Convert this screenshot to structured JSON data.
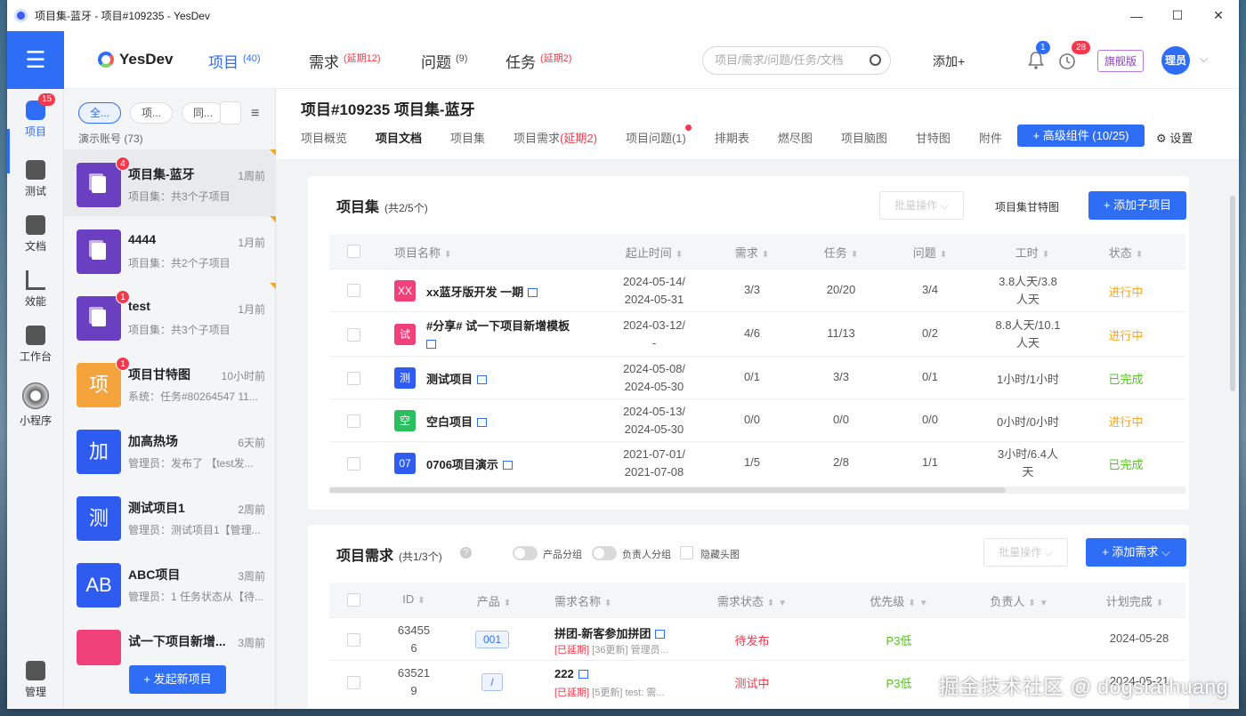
{
  "window": {
    "title": "项目集-蓝牙 - 项目#109235 - YesDev",
    "controls": [
      "—",
      "☐",
      "✕"
    ]
  },
  "rail": {
    "items": [
      {
        "label": "项目",
        "badge": "15",
        "icon": "project-icon"
      },
      {
        "label": "测试",
        "icon": "test-icon"
      },
      {
        "label": "文档",
        "icon": "doc-icon"
      },
      {
        "label": "效能",
        "icon": "chart-icon"
      },
      {
        "label": "工作台",
        "icon": "workbench-icon"
      },
      {
        "label": "小程序",
        "icon": "miniapp-icon"
      },
      {
        "label": "管理",
        "icon": "admin-icon"
      }
    ]
  },
  "header": {
    "logo": "YesDev",
    "nav": [
      {
        "label": "项目",
        "count": "(40)"
      },
      {
        "label": "需求",
        "count": "(延期12)"
      },
      {
        "label": "问题",
        "count": "(9)"
      },
      {
        "label": "任务",
        "count": "(延期2)"
      }
    ],
    "search_placeholder": "项目/需求/问题/任务/文档",
    "add_label": "添加+",
    "bell_badge": "1",
    "clock_badge": "28",
    "edition": "旗舰版",
    "avatar": "理员"
  },
  "listpane": {
    "filters": [
      "全...",
      "项...",
      "同..."
    ],
    "account": "演示账号  (73)",
    "projects": [
      {
        "name": "项目集-蓝牙",
        "time": "1周前",
        "desc": "项目集：共3个子项目",
        "badge": "4",
        "color": "#6b3fc1",
        "pic": ""
      },
      {
        "name": "4444",
        "time": "1月前",
        "desc": "项目集：共2个子项目",
        "badge": "",
        "color": "#6b3fc1",
        "pic": ""
      },
      {
        "name": "test",
        "time": "1月前",
        "desc": "项目集：共3个子项目",
        "badge": "1",
        "color": "#6b3fc1",
        "pic": ""
      },
      {
        "name": "项目甘特图",
        "time": "10小时前",
        "desc": "系统：任务#80264547 11...",
        "badge": "1",
        "color": "#f5a33b",
        "pic": "项"
      },
      {
        "name": "加高热场",
        "time": "6天前",
        "desc": "管理员：发布了 【test发...",
        "badge": "",
        "color": "#2e5bf0",
        "pic": "加"
      },
      {
        "name": "测试项目1",
        "time": "2周前",
        "desc": "管理员：测试项目1【管理...",
        "badge": "",
        "color": "#2e5bf0",
        "pic": "测"
      },
      {
        "name": "ABC项目",
        "time": "3周前",
        "desc": "管理员：1 任务状态从【待...",
        "badge": "",
        "color": "#2e5bf0",
        "pic": "AB"
      },
      {
        "name": "试一下项目新增...",
        "time": "3周前",
        "desc": "",
        "badge": "",
        "color": "#f0417b",
        "pic": ""
      }
    ],
    "new_project": "+ 发起新项目"
  },
  "project": {
    "title": "项目#109235 项目集-蓝牙",
    "tabs": [
      {
        "label": "项目概览",
        "extra": ""
      },
      {
        "label": "项目文档",
        "extra": ""
      },
      {
        "label": "项目集",
        "extra": ""
      },
      {
        "label": "项目需求",
        "extra": "(延期2)"
      },
      {
        "label": "项目问题(1)",
        "extra": ""
      },
      {
        "label": "排期表",
        "extra": ""
      },
      {
        "label": "燃尽图",
        "extra": ""
      },
      {
        "label": "项目脑图",
        "extra": ""
      },
      {
        "label": "甘特图",
        "extra": ""
      },
      {
        "label": "附件",
        "extra": ""
      }
    ],
    "adv_button": "+ 高级组件 (10/25)",
    "settings": "设置"
  },
  "subprojects": {
    "title": "项目集",
    "count": "(共2/5个)",
    "batch": "批量操作",
    "gantt_link": "项目集甘特图",
    "add_button": "+ 添加子项目",
    "columns": [
      "项目名称",
      "起止时间",
      "需求",
      "任务",
      "问题",
      "工时",
      "状态"
    ],
    "rows": [
      {
        "tag": "XX",
        "tag_color": "#f0417b",
        "name": "xx蓝牙版开发 一期",
        "name2": "",
        "start": "2024-05-14/",
        "end": "2024-05-31",
        "req": "3/3",
        "task": "20/20",
        "issue": "3/4",
        "hours1": "3.8人天/3.8",
        "hours2": "人天",
        "status": "进行中",
        "status_class": "st-blue"
      },
      {
        "tag": "试",
        "tag_color": "#f0417b",
        "name": "#分享# 试一下项目新增模板",
        "name2": "",
        "start": "2024-03-12/",
        "end": "-",
        "req": "4/6",
        "task": "11/13",
        "issue": "0/2",
        "hours1": "8.8人天/10.1",
        "hours2": "人天",
        "status": "进行中",
        "status_class": "st-blue"
      },
      {
        "tag": "测",
        "tag_color": "#2e5bf0",
        "name": "测试项目",
        "name2": "",
        "start": "2024-05-08/",
        "end": "2024-05-30",
        "req": "0/1",
        "task": "3/3",
        "issue": "0/1",
        "hours1": "1小时/1小时",
        "hours2": "",
        "status": "已完成",
        "status_class": "st-green"
      },
      {
        "tag": "空",
        "tag_color": "#2bbf5f",
        "name": "空白项目",
        "name2": "",
        "start": "2024-05-13/",
        "end": "2024-05-30",
        "req": "0/0",
        "task": "0/0",
        "issue": "0/0",
        "hours1": "0小时/0小时",
        "hours2": "",
        "status": "进行中",
        "status_class": "st-blue"
      },
      {
        "tag": "07",
        "tag_color": "#2e5bf0",
        "name": "0706项目演示",
        "name2": "",
        "start": "2021-07-01/",
        "end": "2021-07-08",
        "req": "1/5",
        "task": "2/8",
        "issue": "1/1",
        "hours1": "3小时/6.4人",
        "hours2": "天",
        "status": "已完成",
        "status_class": "st-green"
      }
    ]
  },
  "requirements": {
    "title": "项目需求",
    "count": "(共1/3个)",
    "toggle1": "产品分组",
    "toggle2": "负责人分组",
    "check1": "隐藏头图",
    "batch": "批量操作",
    "add_button": "+ 添加需求",
    "columns": [
      "ID",
      "产品",
      "需求名称",
      "需求状态",
      "优先级",
      "负责人",
      "计划完成"
    ],
    "rows": [
      {
        "id1": "63455",
        "id2": "6",
        "product": "001",
        "name": "拼团-新客参加拼团",
        "delay": "[已延期]",
        "sub": " [36更新] 管理员...",
        "status": "待发布",
        "prio": "P3低",
        "owner": "",
        "due": "2024-05-28"
      },
      {
        "id1": "63521",
        "id2": "9",
        "product": "/",
        "name": "222",
        "delay": "[已延期]",
        "sub": " [5更新] test: 需...",
        "status": "测试中",
        "prio": "P3低",
        "owner": "",
        "due": "2024-05-21"
      }
    ]
  },
  "watermark": "掘金技术社区 @ dogstarhuang"
}
